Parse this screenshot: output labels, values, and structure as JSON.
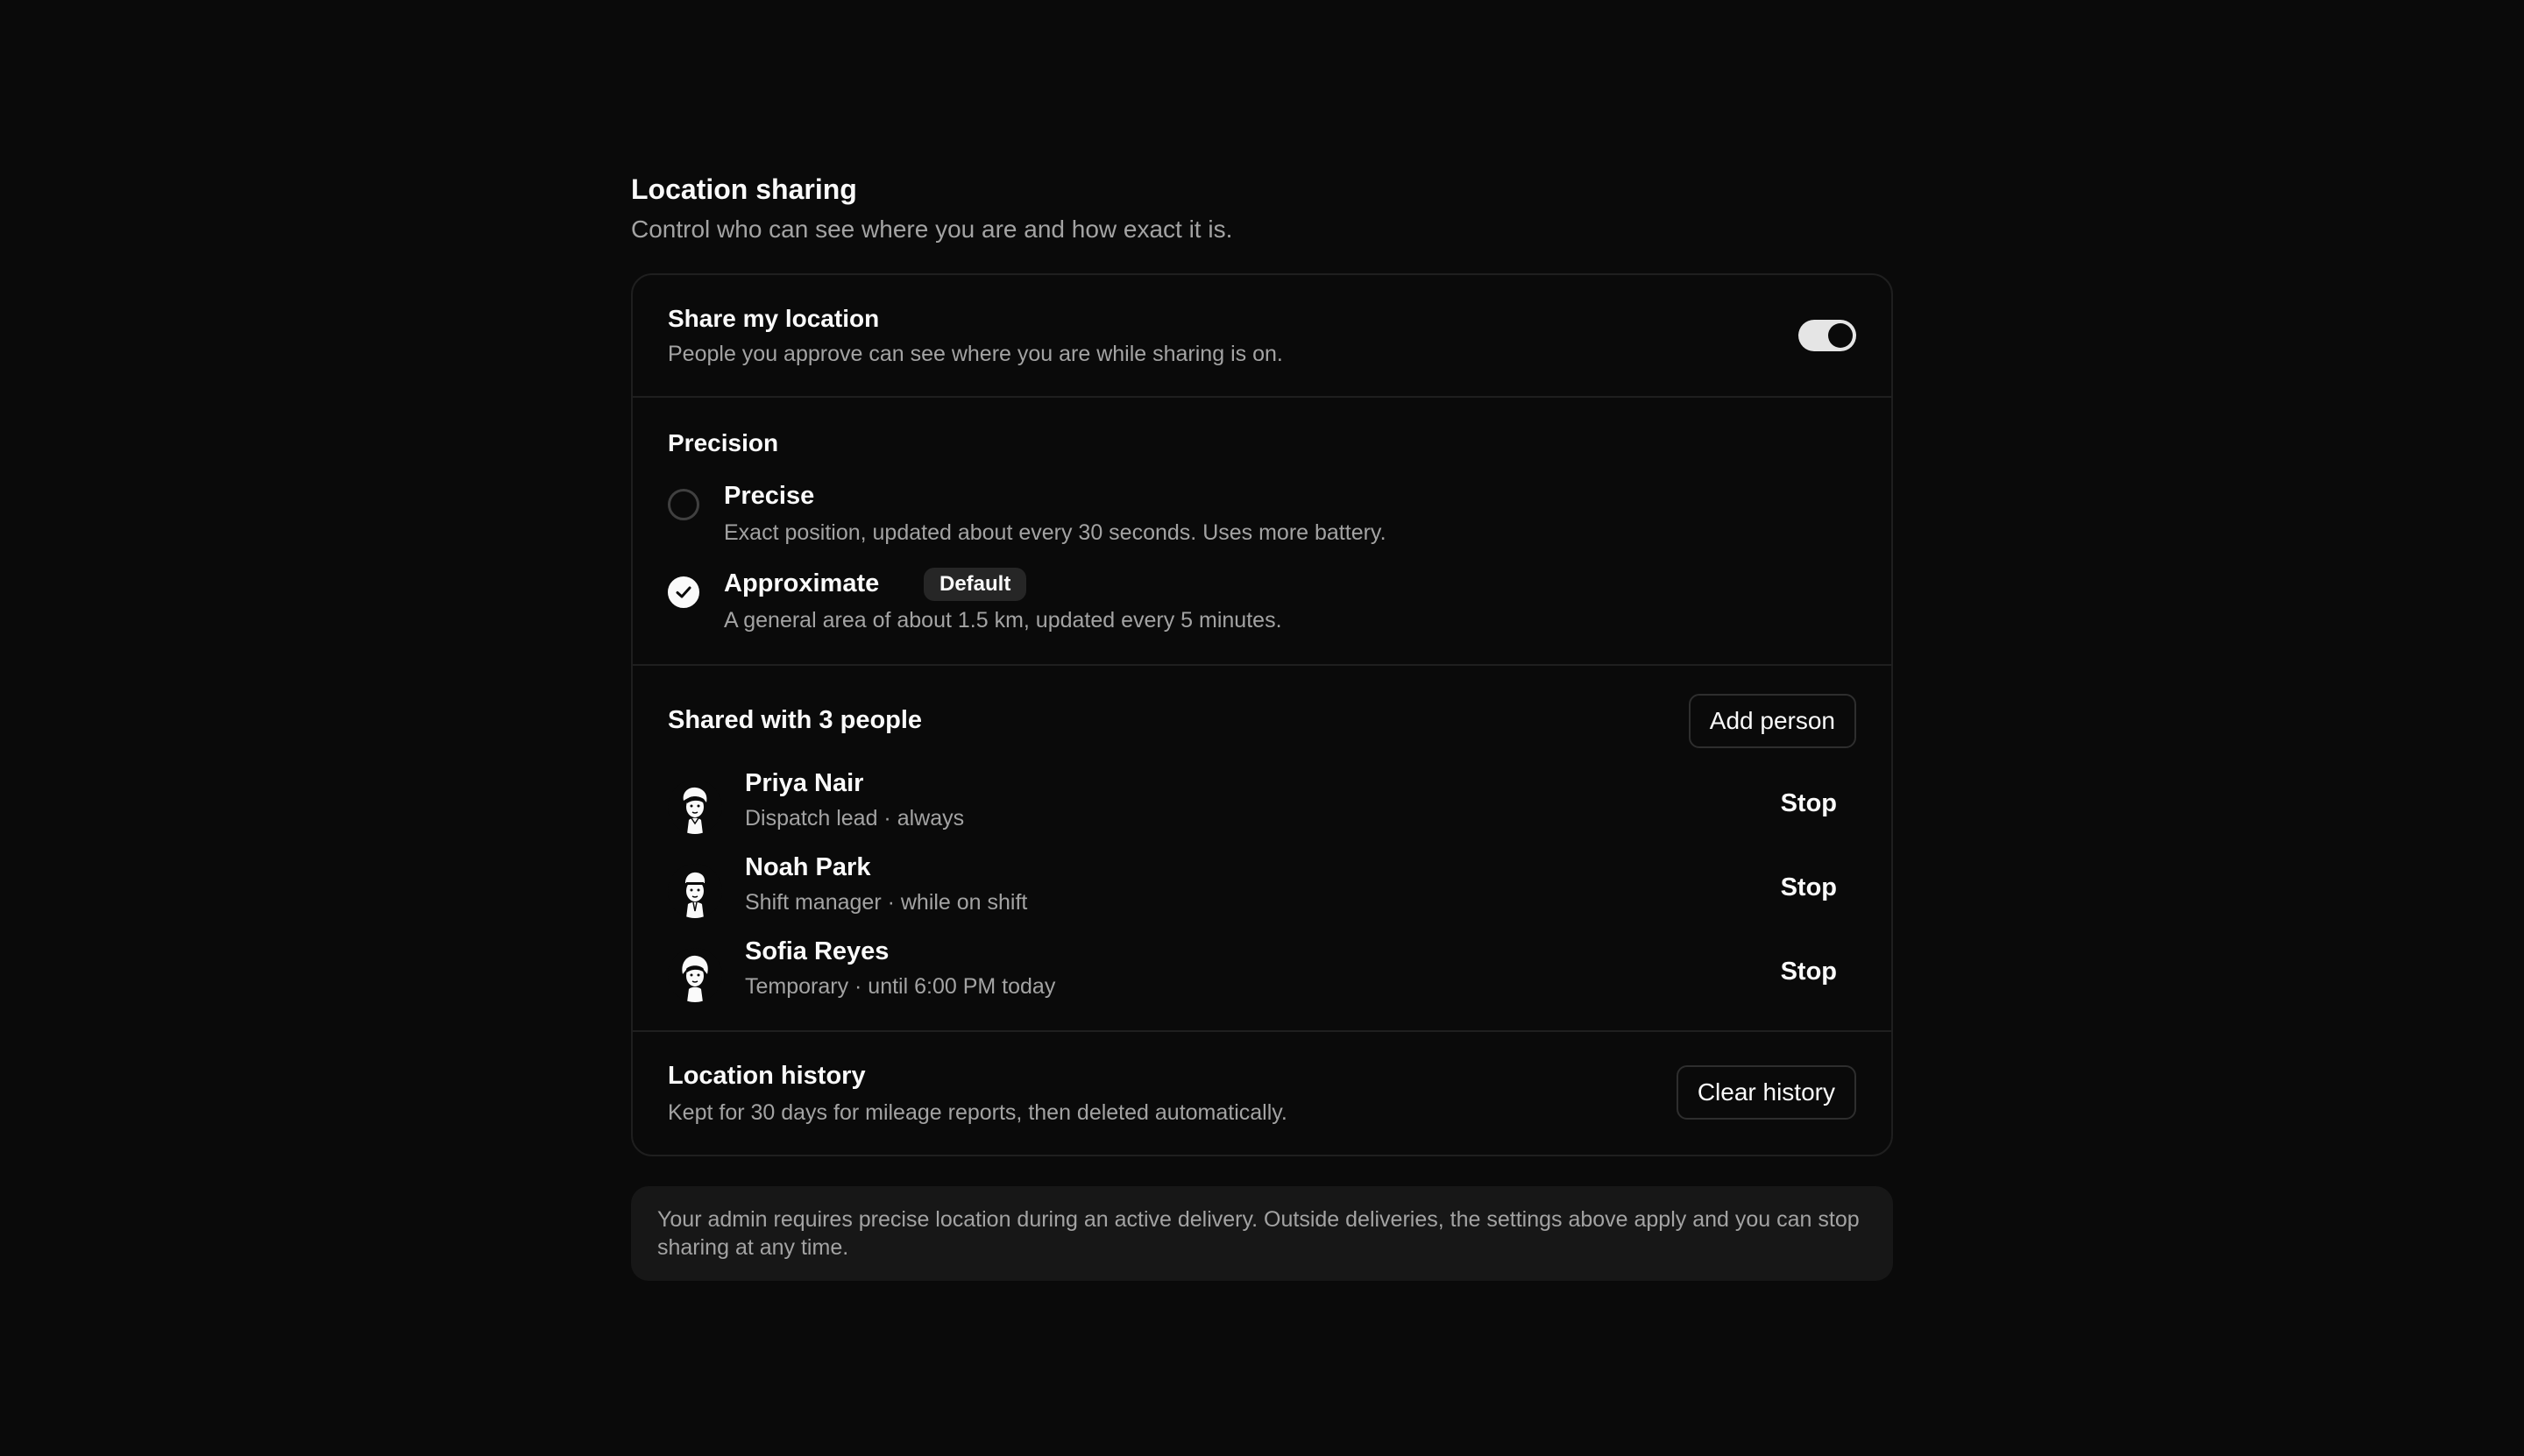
{
  "header": {
    "title": "Location sharing",
    "subtitle": "Control who can see where you are and how exact it is."
  },
  "share": {
    "title": "Share my location",
    "description": "People you approve can see where you are while sharing is on.",
    "enabled": true
  },
  "precision": {
    "title": "Precision",
    "options": [
      {
        "label": "Precise",
        "description": "Exact position, updated about every 30 seconds. Uses more battery.",
        "selected": false
      },
      {
        "label": "Approximate",
        "badge": "Default",
        "description": "A general area of about 1.5 km, updated every 5 minutes.",
        "selected": true
      }
    ]
  },
  "people": {
    "title": "Shared with 3 people",
    "add_label": "Add person",
    "list": [
      {
        "name": "Priya Nair",
        "meta": "Dispatch lead · always",
        "action": "Stop"
      },
      {
        "name": "Noah Park",
        "meta": "Shift manager · while on shift",
        "action": "Stop"
      },
      {
        "name": "Sofia Reyes",
        "meta": "Temporary · until 6:00 PM today",
        "action": "Stop"
      }
    ]
  },
  "history": {
    "title": "Location history",
    "description": "Kept for 30 days for mileage reports, then deleted automatically.",
    "clear_label": "Clear history"
  },
  "notice": {
    "text": "Your admin requires precise location during an active delivery. Outside deliveries, the settings above apply and you can stop sharing at any time."
  },
  "colors": {
    "background": "#0a0a0a",
    "surface": "#171717",
    "border": "#1f1f1f",
    "text": "#fafafa",
    "muted": "#a3a3a3"
  }
}
